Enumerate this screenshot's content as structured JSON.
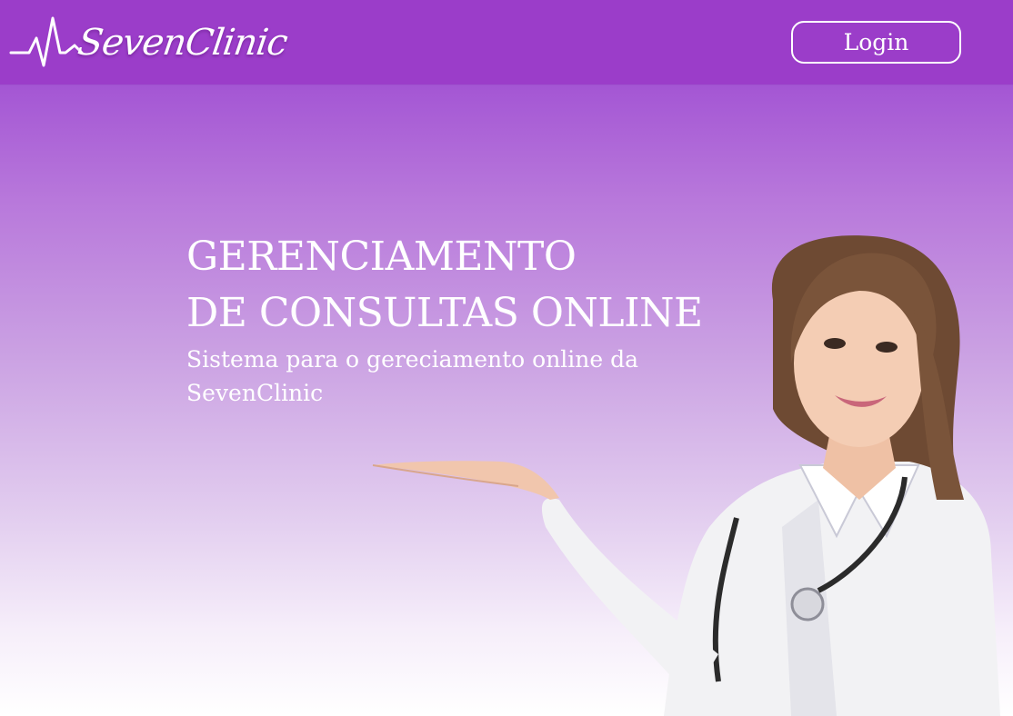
{
  "header": {
    "logo_text": "SevenClinic",
    "login_label": "Login"
  },
  "hero": {
    "title_line1": "GERENCIAMENTO",
    "title_line2": "DE CONSULTAS ONLINE",
    "subtitle": "Sistema para o gereciamento online da SevenClinic"
  },
  "colors": {
    "brand_purple": "#9b3dc9",
    "text": "#ffffff"
  },
  "icons": {
    "logo": "heartbeat-pulse-icon",
    "hero_image": "doctor-photo"
  }
}
